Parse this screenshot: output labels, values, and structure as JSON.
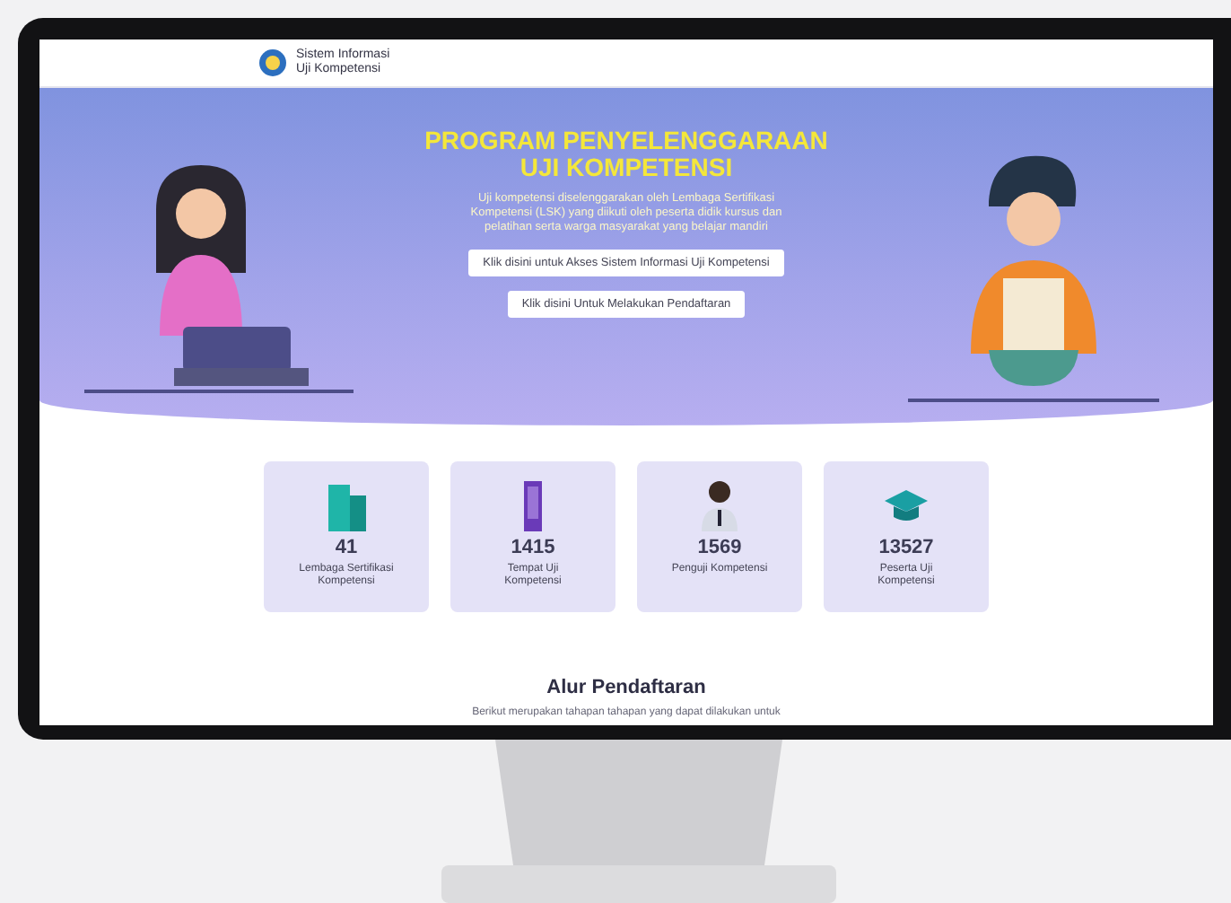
{
  "header": {
    "logo_lines": [
      "Sistem Informasi",
      "Uji Kompetensi"
    ]
  },
  "hero": {
    "title_lines": [
      "PROGRAM PENYELENGGARAAN",
      "UJI KOMPETENSI"
    ],
    "description": "Uji kompetensi diselenggarakan oleh Lembaga Sertifikasi Kompetensi (LSK) yang diikuti oleh peserta didik kursus dan pelatihan serta warga masyarakat yang belajar mandiri",
    "buttons": [
      "Klik disini untuk Akses Sistem Informasi Uji Kompetensi",
      "Klik disini Untuk Melakukan Pendaftaran"
    ]
  },
  "stats": [
    {
      "kind": "institution",
      "value": "41",
      "label": "Lembaga Sertifikasi Kompetensi"
    },
    {
      "kind": "venue",
      "value": "1415",
      "label": "Tempat Uji Kompetensi"
    },
    {
      "kind": "examiner",
      "value": "1569",
      "label": "Penguji Kompetensi"
    },
    {
      "kind": "participant",
      "value": "13527",
      "label": "Peserta Uji Kompetensi"
    }
  ],
  "section": {
    "title": "Alur Pendaftaran",
    "subtitle": "Berikut merupakan tahapan tahapan yang dapat dilakukan untuk"
  }
}
